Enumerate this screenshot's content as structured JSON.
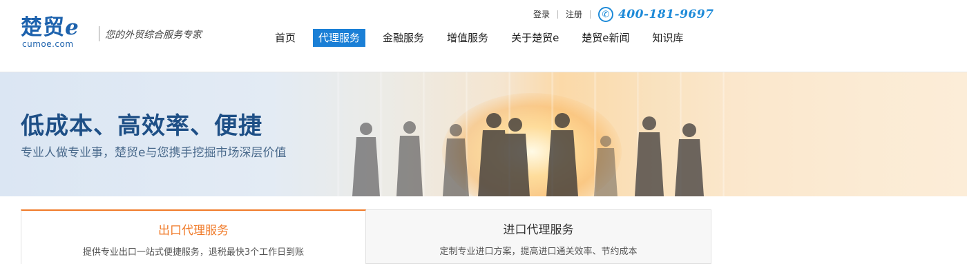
{
  "brand": {
    "logo_text": "楚贸",
    "logo_letter": "e",
    "domain": "cumoe.com",
    "slogan": "您的外贸综合服务专家"
  },
  "toplinks": {
    "login": "登录",
    "register": "注册"
  },
  "hotline": {
    "icon": "phone-icon",
    "number": "400-181-9697",
    "color": "#1d8ad8"
  },
  "nav": {
    "items": [
      {
        "label": "首页",
        "active": false
      },
      {
        "label": "代理服务",
        "active": true
      },
      {
        "label": "金融服务",
        "active": false
      },
      {
        "label": "增值服务",
        "active": false
      },
      {
        "label": "关于楚贸e",
        "active": false
      },
      {
        "label": "楚贸e新闻",
        "active": false
      },
      {
        "label": "知识库",
        "active": false
      }
    ],
    "active_color": "#1a7fd6"
  },
  "banner": {
    "title": "低成本、高效率、便捷",
    "subtitle": "专业人做专业事，楚贸e与您携手挖掘市场深层价值"
  },
  "tabs": [
    {
      "title": "出口代理服务",
      "desc": "提供专业出口一站式便捷服务，退税最快3个工作日到账",
      "active": true
    },
    {
      "title": "进口代理服务",
      "desc": "定制专业进口方案，提高进口通关效率、节约成本",
      "active": false
    }
  ],
  "colors": {
    "brand_blue": "#1d62ad",
    "accent_orange": "#f07a28"
  }
}
